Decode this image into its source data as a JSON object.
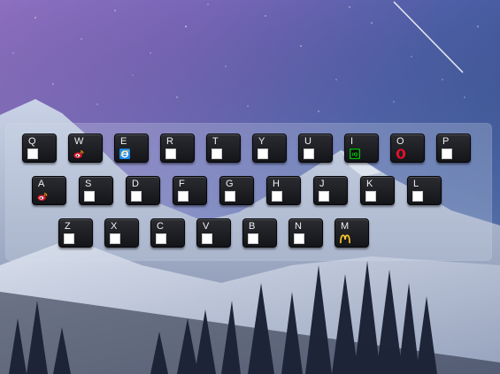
{
  "keyboard": {
    "rows": [
      [
        {
          "label": "Q",
          "icon": "blank-box"
        },
        {
          "label": "W",
          "icon": "weibo-icon"
        },
        {
          "label": "E",
          "icon": "ie-browser-icon"
        },
        {
          "label": "R",
          "icon": "blank-box"
        },
        {
          "label": "T",
          "icon": "blank-box"
        },
        {
          "label": "Y",
          "icon": "blank-box"
        },
        {
          "label": "U",
          "icon": "blank-box"
        },
        {
          "label": "I",
          "icon": "iqiyi-icon"
        },
        {
          "label": "O",
          "icon": "opera-icon"
        },
        {
          "label": "P",
          "icon": "blank-box"
        }
      ],
      [
        {
          "label": "A",
          "icon": "weibo-icon"
        },
        {
          "label": "S",
          "icon": "blank-box"
        },
        {
          "label": "D",
          "icon": "blank-box"
        },
        {
          "label": "F",
          "icon": "blank-box"
        },
        {
          "label": "G",
          "icon": "blank-box"
        },
        {
          "label": "H",
          "icon": "blank-box"
        },
        {
          "label": "J",
          "icon": "blank-box"
        },
        {
          "label": "K",
          "icon": "blank-box"
        },
        {
          "label": "L",
          "icon": "blank-box"
        }
      ],
      [
        {
          "label": "Z",
          "icon": "blank-box"
        },
        {
          "label": "X",
          "icon": "blank-box"
        },
        {
          "label": "C",
          "icon": "blank-box"
        },
        {
          "label": "V",
          "icon": "blank-box"
        },
        {
          "label": "B",
          "icon": "blank-box"
        },
        {
          "label": "N",
          "icon": "blank-box"
        },
        {
          "label": "M",
          "icon": "mcdonalds-icon"
        }
      ]
    ]
  },
  "colors": {
    "sky_top_left": "#8b6fbf",
    "sky_top_right": "#3e5a9c",
    "panel_tint": "#d2daeb",
    "key_face": "#1d1e22"
  }
}
